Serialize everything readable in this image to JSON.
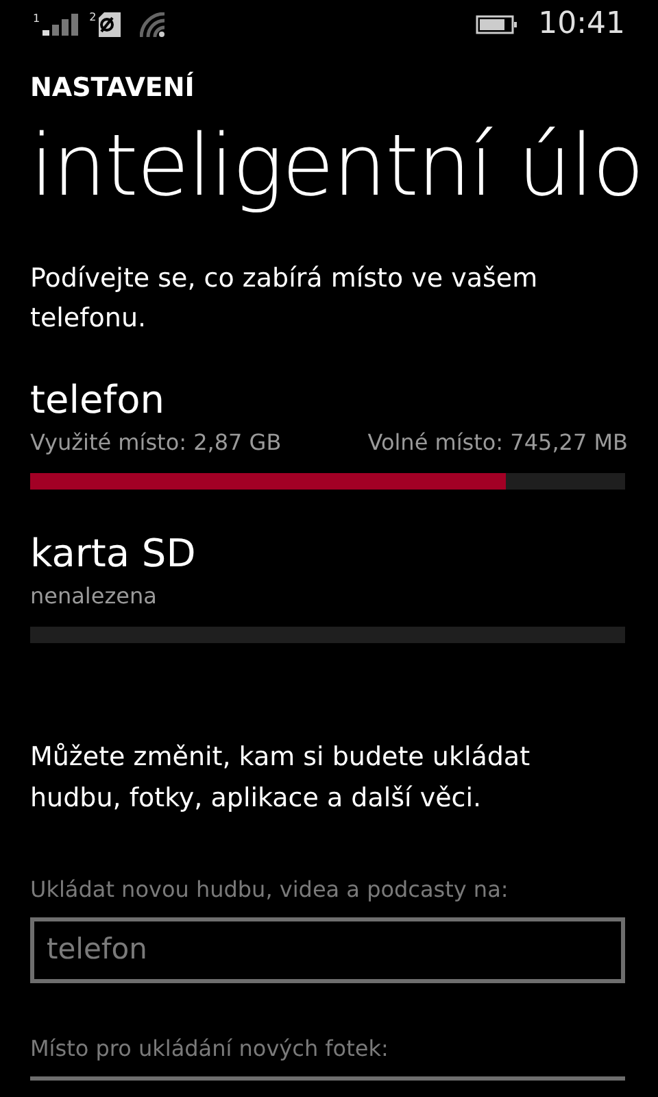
{
  "status_bar": {
    "sim_1": "1",
    "sim_2": "2",
    "time": "10:41"
  },
  "header": {
    "app": "NASTAVENÍ",
    "title": "inteligentní úlo"
  },
  "intro": "Podívejte se, co zabírá místo ve vašem telefonu.",
  "storages": [
    {
      "name": "telefon",
      "details": [
        "Využité místo: 2,87 GB",
        "Volné místo: 745,27 MB"
      ],
      "level": 0.8
    },
    {
      "name": "karta SD",
      "details": [
        "nenalezena"
      ],
      "level": 0
    }
  ],
  "change_text": "Můžete změnit, kam si budete ukládat hudbu, fotky, aplikace a další věci.",
  "pickers": [
    {
      "label": "Ukládat novou hudbu, videa a podcasty na:",
      "value": "telefon",
      "disabled": true
    },
    {
      "label": "Místo pro ukládání nových fotek:",
      "disabled": true
    }
  ]
}
